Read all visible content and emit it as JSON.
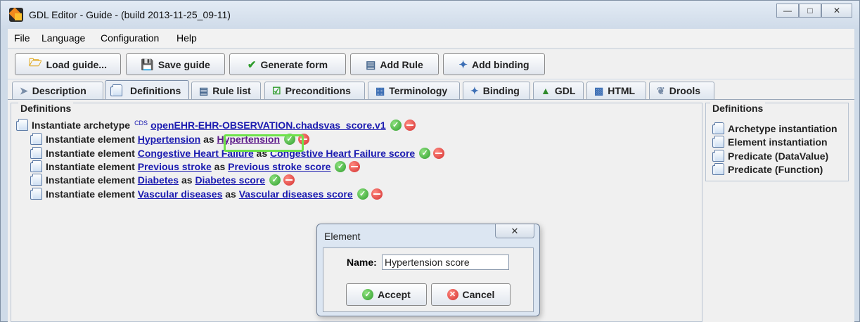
{
  "window": {
    "title": "GDL Editor - Guide - (build 2013-11-25_09-11)"
  },
  "menu": [
    "File",
    "Language",
    "Configuration",
    "Help"
  ],
  "toolbar": {
    "load": "Load guide...",
    "save": "Save guide",
    "generate": "Generate form",
    "add_rule": "Add Rule",
    "add_binding": "Add binding"
  },
  "tabs": [
    "Description",
    "Definitions",
    "Rule list",
    "Preconditions",
    "Terminology",
    "Binding",
    "GDL",
    "HTML",
    "Drools"
  ],
  "definitions": {
    "legend": "Definitions",
    "archetype_prefix": "Instantiate archetype",
    "cds": "CDS",
    "archetype": "openEHR-EHR-OBSERVATION.chadsvas_score.v1",
    "element_prefix": "Instantiate element",
    "as": "as",
    "elements": [
      {
        "name": "Hypertension",
        "alias": "Hypertension"
      },
      {
        "name": "Congestive Heart Failure",
        "alias": "Congestive Heart Failure score"
      },
      {
        "name": "Previous stroke",
        "alias": "Previous stroke score"
      },
      {
        "name": "Diabetes",
        "alias": "Diabetes score"
      },
      {
        "name": "Vascular diseases",
        "alias": "Vascular diseases score"
      }
    ]
  },
  "palette": {
    "legend": "Definitions",
    "items": [
      "Archetype instantiation",
      "Element instantiation",
      "Predicate (DataValue)",
      "Predicate (Function)"
    ]
  },
  "dialog": {
    "title": "Element",
    "name_label": "Name:",
    "name_value": "Hypertension score",
    "accept": "Accept",
    "cancel": "Cancel"
  }
}
